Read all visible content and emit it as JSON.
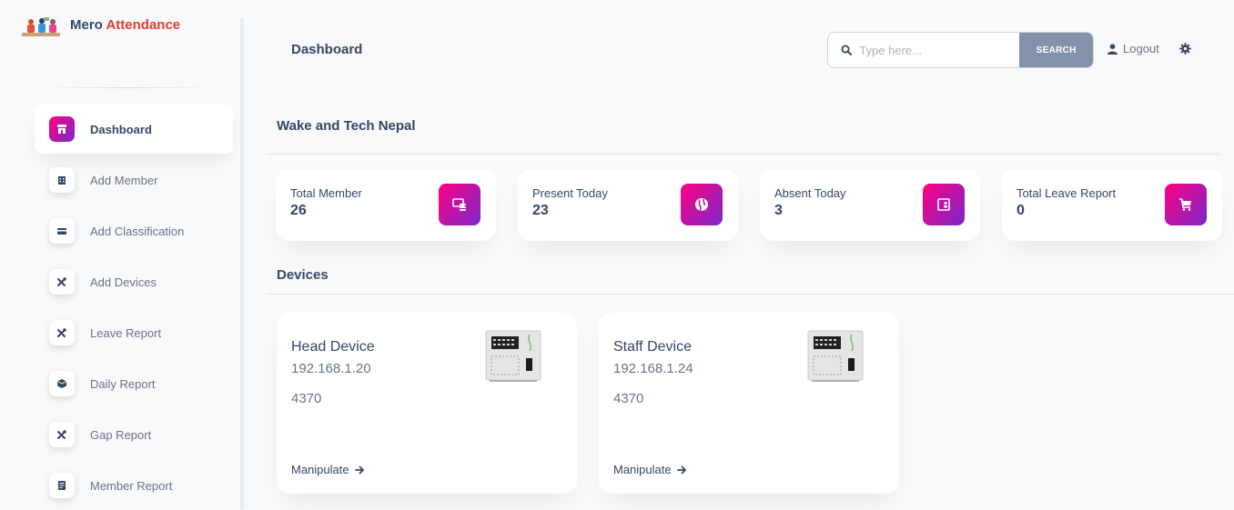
{
  "brand": {
    "name_part1": "Mero ",
    "name_part2": "Attendance"
  },
  "sidebar": {
    "items": [
      {
        "label": "Dashboard",
        "icon": "shop-icon",
        "active": true
      },
      {
        "label": "Add Member",
        "icon": "office-icon"
      },
      {
        "label": "Add Classification",
        "icon": "credit-card-icon"
      },
      {
        "label": "Add Devices",
        "icon": "tools-icon"
      },
      {
        "label": "Leave Report",
        "icon": "tools-icon"
      },
      {
        "label": "Daily Report",
        "icon": "box-icon"
      },
      {
        "label": "Gap Report",
        "icon": "tools-icon"
      },
      {
        "label": "Member Report",
        "icon": "document-icon"
      }
    ]
  },
  "header": {
    "title": "Dashboard",
    "search": {
      "placeholder": "Type here...",
      "button_label": "SEARCH"
    },
    "logout_label": "Logout"
  },
  "company": {
    "name": "Wake and Tech Nepal"
  },
  "stats": [
    {
      "label": "Total Member",
      "value": "26",
      "icon": "screen-icon"
    },
    {
      "label": "Present Today",
      "value": "23",
      "icon": "world-icon"
    },
    {
      "label": "Absent Today",
      "value": "3",
      "icon": "badge-icon"
    },
    {
      "label": "Total Leave Report",
      "value": "0",
      "icon": "cart-icon"
    }
  ],
  "devices_section": {
    "title": "Devices"
  },
  "devices": [
    {
      "name": "Head Device",
      "ip": "192.168.1.20",
      "port": "4370",
      "action": "Manipulate"
    },
    {
      "name": "Staff Device",
      "ip": "192.168.1.24",
      "port": "4370",
      "action": "Manipulate"
    }
  ],
  "colors": {
    "gradient_start": "#7928ca",
    "gradient_end": "#ff0080",
    "brand_accent": "#e53935",
    "search_button": "#8392ab",
    "text_primary": "#344767",
    "text_secondary": "#67748e"
  }
}
